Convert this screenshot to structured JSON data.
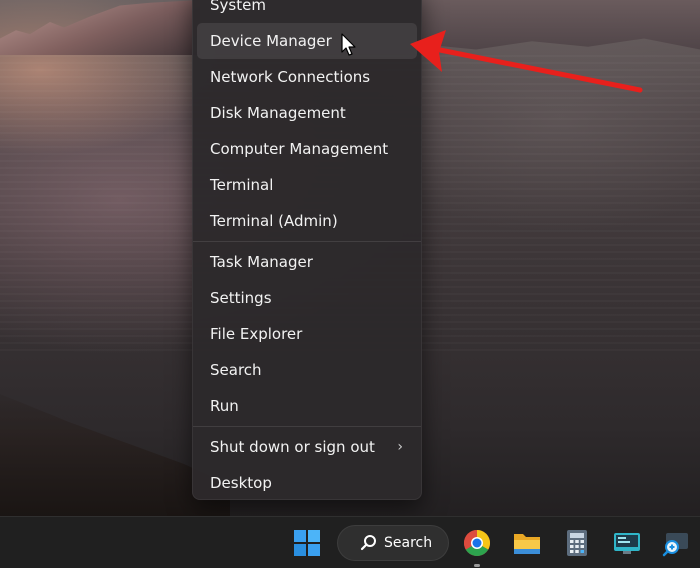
{
  "menu": {
    "items": [
      {
        "label": "System"
      },
      {
        "label": "Device Manager"
      },
      {
        "label": "Network Connections"
      },
      {
        "label": "Disk Management"
      },
      {
        "label": "Computer Management"
      },
      {
        "label": "Terminal"
      },
      {
        "label": "Terminal (Admin)"
      },
      {
        "label": "Task Manager"
      },
      {
        "label": "Settings"
      },
      {
        "label": "File Explorer"
      },
      {
        "label": "Search"
      },
      {
        "label": "Run"
      },
      {
        "label": "Shut down or sign out",
        "submenu_icon": "chevron-right-icon"
      },
      {
        "label": "Desktop"
      }
    ],
    "hovered_item": "Device Manager"
  },
  "annotation": {
    "arrow_color": "#e8201c"
  },
  "taskbar": {
    "search_label": "Search",
    "icons": [
      "windows-start-icon",
      "search-icon",
      "chrome-icon",
      "file-explorer-icon",
      "calculator-icon",
      "remote-desktop-icon",
      "magnifier-icon"
    ]
  },
  "colors": {
    "menu_background": "#2c292b",
    "taskbar_background": "#202020",
    "accent_blue": "#3aa0f0"
  }
}
